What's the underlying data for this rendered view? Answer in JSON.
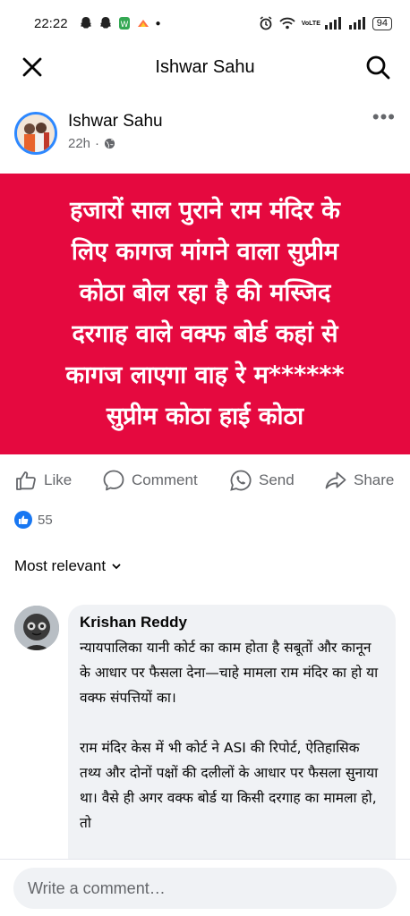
{
  "status_bar": {
    "time": "22:22",
    "battery": "94",
    "network_label": "VoLTE"
  },
  "header": {
    "title": "Ishwar Sahu"
  },
  "post": {
    "author": "Ishwar Sahu",
    "time_ago": "22h",
    "visibility_separator": "·",
    "more_label": "•••",
    "image_text_lines": [
      "हजारों साल पुराने राम मंदिर के",
      "लिए कागज मांगने वाला सुप्रीम",
      "कोठा बोल रहा है की मस्जिद",
      "दरगाह वाले वक्फ बोर्ड कहां से",
      "कागज लाएगा वाह रे म******",
      "सुप्रीम कोठा हाई कोठा"
    ],
    "image_bg_color": "#e5093f"
  },
  "actions": {
    "like": "Like",
    "comment": "Comment",
    "send": "Send",
    "share": "Share"
  },
  "reactions": {
    "count": "55"
  },
  "sort": {
    "label": "Most relevant"
  },
  "comment": {
    "author": "Krishan Reddy",
    "paragraph_1": "न्यायपालिका यानी कोर्ट का काम होता है सबूतों और कानून के आधार पर फैसला देना—चाहे मामला राम मंदिर का हो या वक्फ संपत्तियों का।",
    "paragraph_2": "राम मंदिर केस में भी कोर्ट ने ASI की रिपोर्ट, ऐतिहासिक तथ्य और दोनों पक्षों की दलीलों के आधार पर फैसला सुनाया था। वैसे ही अगर वक्फ बोर्ड या किसी दरगाह का मामला हो, तो"
  },
  "composer": {
    "placeholder": "Write a comment…"
  }
}
